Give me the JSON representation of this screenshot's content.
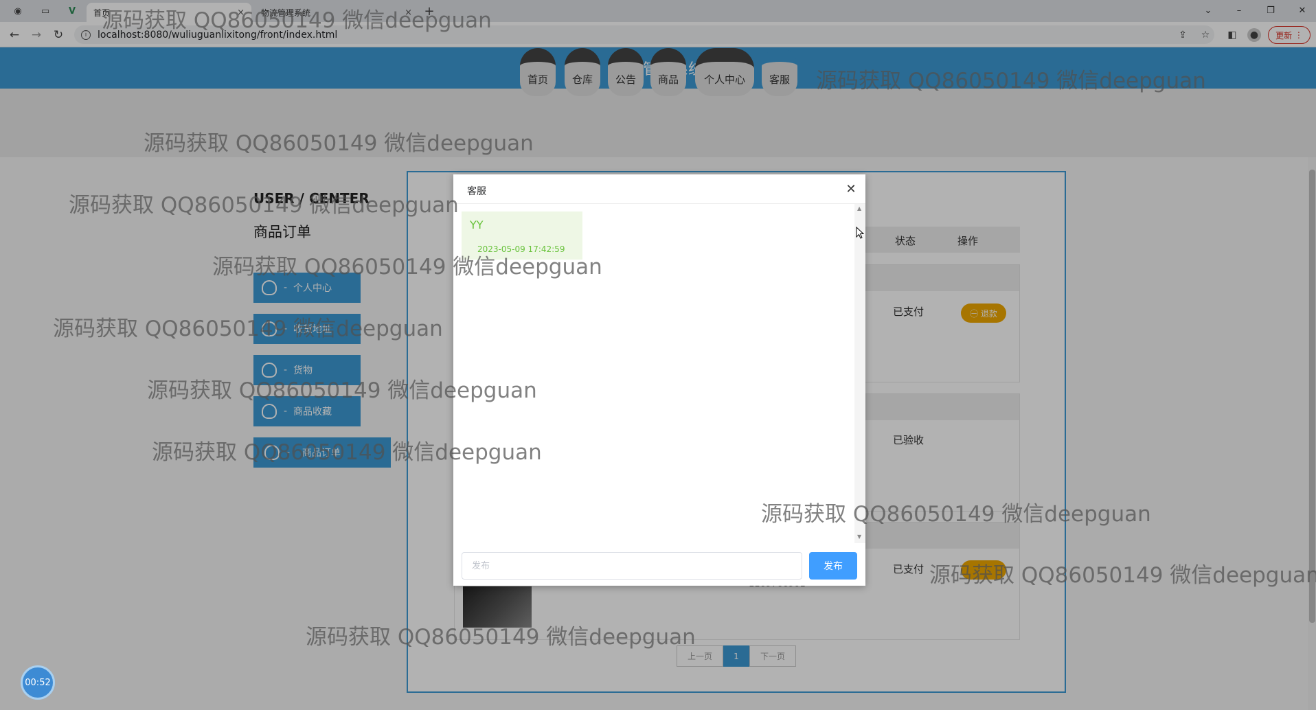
{
  "browser": {
    "tabs": [
      {
        "title": "首页",
        "close": "×"
      },
      {
        "title": "物流管理系统",
        "close": "×"
      }
    ],
    "new_tab": "+",
    "url": "localhost:8080/wuliuguanlixitong/front/index.html",
    "update_label": "更新",
    "win_controls": {
      "chevron": "⌄",
      "minimize": "–",
      "restore": "❐",
      "close": "✕"
    }
  },
  "site": {
    "title": "物流管理系统",
    "nav": [
      "首页",
      "仓库",
      "公告",
      "商品",
      "个人中心",
      "客服"
    ],
    "active_nav": "客服"
  },
  "sidebar": {
    "heading": "USER / CENTER",
    "subheading": "商品订单",
    "items": [
      "个人中心",
      "收货地址",
      "货物",
      "商品收藏",
      "商品订单"
    ]
  },
  "orders": {
    "columns": [
      "状态",
      "操作"
    ],
    "rows": [
      {
        "status": "已支付",
        "action": "退款"
      },
      {
        "status": "已验收",
        "action": ""
      },
      {
        "status": "已支付",
        "action": ""
      }
    ],
    "partial_number": "1169766901"
  },
  "pagination": {
    "prev": "上一页",
    "current": "1",
    "next": "下一页"
  },
  "dialog": {
    "title": "客服",
    "close": "✕",
    "message": {
      "sender": "YY",
      "time": "2023-05-09 17:42:59"
    },
    "input_placeholder": "发布",
    "send_label": "发布"
  },
  "timer": "00:52",
  "watermarks": [
    "源码获取 QQ86050149 微信deepguan",
    "源码获取 QQ86050149 微信deepguan",
    "源码获取 QQ86050149 微信deepguan",
    "源码获取 QQ86050149 微信deepguan",
    "源码获取 QQ86050149 微信deepguan",
    "源码获取 QQ86050149 微信deepguan",
    "源码获取 QQ86050149 微信deepguan",
    "源码获取 QQ86050149 微信deepguan",
    "源码获取 QQ86050149 微信deepguan",
    "源码获取 QQ86050149 微信deepguan",
    "源码获取 QQ86050149 微信deepguan"
  ],
  "colors": {
    "accent": "#3d9ad4",
    "send_button": "#409eff",
    "chat_text": "#67c23a",
    "refund": "#f0a800"
  }
}
